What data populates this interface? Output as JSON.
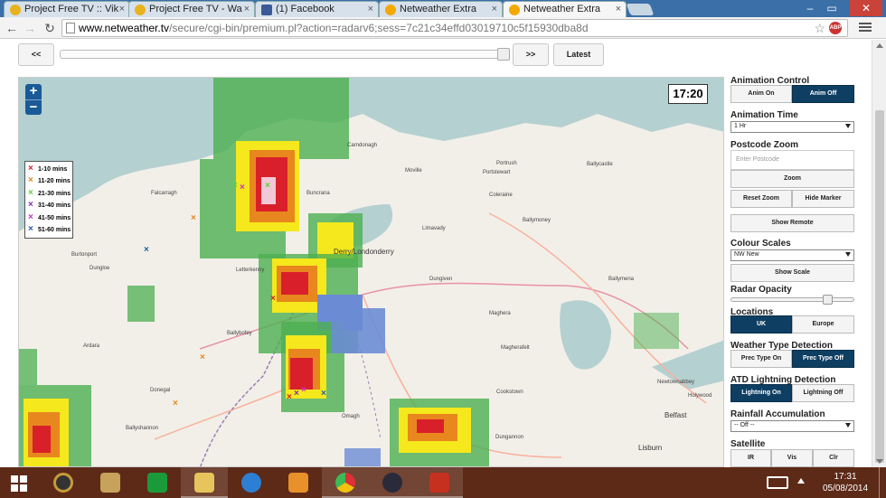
{
  "browser": {
    "tabs": [
      {
        "title": "Project Free TV :: Vik",
        "favicon_color": "#e8b21c"
      },
      {
        "title": "Project Free TV - Wa",
        "favicon_color": "#e8b21c"
      },
      {
        "title": "(1) Facebook",
        "favicon_color": "#3b5998"
      },
      {
        "title": "Netweather Extra",
        "favicon_color": "#f2a900"
      },
      {
        "title": "Netweather Extra",
        "favicon_color": "#f2a900"
      }
    ],
    "active_tab": 4,
    "url_host": "www.netweather.tv",
    "url_rest": "/secure/cgi-bin/premium.pl?action=radarv6;sess=7c21c34effd03019710c5f15930dba8d",
    "adblock_label": "ABP"
  },
  "controls": {
    "prev_label": "<<",
    "next_label": ">>",
    "latest_label": "Latest"
  },
  "map": {
    "time": "17:20",
    "zoom_in": "+",
    "zoom_out": "−",
    "legend": [
      {
        "label": "1-10 mins",
        "color": "#d9202a"
      },
      {
        "label": "11-20 mins",
        "color": "#e8871d"
      },
      {
        "label": "21-30 mins",
        "color": "#5ed13c"
      },
      {
        "label": "31-40 mins",
        "color": "#8b2ab5"
      },
      {
        "label": "41-50 mins",
        "color": "#d12bc9"
      },
      {
        "label": "51-60 mins",
        "color": "#1f5fa8"
      }
    ],
    "places": [
      {
        "name": "Carndonagh"
      },
      {
        "name": "Moville"
      },
      {
        "name": "Portrush"
      },
      {
        "name": "Ballycastle"
      },
      {
        "name": "Portstewart"
      },
      {
        "name": "Falcarragh"
      },
      {
        "name": "Buncrana"
      },
      {
        "name": "Coleraine"
      },
      {
        "name": "Ballymoney"
      },
      {
        "name": "Limavady"
      },
      {
        "name": "Burtonport"
      },
      {
        "name": "Derry/Londonderry"
      },
      {
        "name": "Dungloe"
      },
      {
        "name": "Letterkenny"
      },
      {
        "name": "Dungiven"
      },
      {
        "name": "Ballymena"
      },
      {
        "name": "Maghera"
      },
      {
        "name": "Ballybofey"
      },
      {
        "name": "Ardara"
      },
      {
        "name": "Magherafelt"
      },
      {
        "name": "Donegal"
      },
      {
        "name": "Cookstown"
      },
      {
        "name": "Omagh"
      },
      {
        "name": "Newtownabbey"
      },
      {
        "name": "Holywood"
      },
      {
        "name": "Belfast"
      },
      {
        "name": "Ballyshannon"
      },
      {
        "name": "Dungannon"
      },
      {
        "name": "Lisburn"
      }
    ]
  },
  "sidebar": {
    "animation_control": {
      "heading": "Animation Control",
      "on": "Anim On",
      "off": "Anim Off"
    },
    "animation_time": {
      "heading": "Animation Time",
      "value": "1 Hr"
    },
    "postcode_zoom": {
      "heading": "Postcode Zoom",
      "placeholder": "Enter Postcode",
      "zoom": "Zoom",
      "reset": "Reset Zoom",
      "hide_marker": "Hide Marker"
    },
    "show_remote": "Show Remote",
    "colour_scales": {
      "heading": "Colour Scales",
      "value": "NW New",
      "show": "Show Scale"
    },
    "radar_opacity": {
      "heading": "Radar Opacity",
      "level": 0.78
    },
    "locations": {
      "heading": "Locations",
      "uk": "UK",
      "europe": "Europe"
    },
    "weather_type": {
      "heading": "Weather Type Detection",
      "on": "Prec Type On",
      "off": "Prec Type Off"
    },
    "atd": {
      "heading": "ATD Lightning Detection",
      "on": "Lightning On",
      "off": "Lightning Off"
    },
    "rainfall": {
      "heading": "Rainfall Accumulation",
      "value": "-- Off --"
    },
    "satellite": {
      "heading": "Satellite",
      "ir": "IR",
      "vis": "Vis",
      "clr": "Clr"
    }
  },
  "taskbar": {
    "time": "17:31",
    "date": "05/08/2014"
  },
  "colors": {
    "accent": "#0e3f63",
    "taskbar": "#5d2a18",
    "sea": "#b5d0d0",
    "land": "#f2efe9"
  }
}
